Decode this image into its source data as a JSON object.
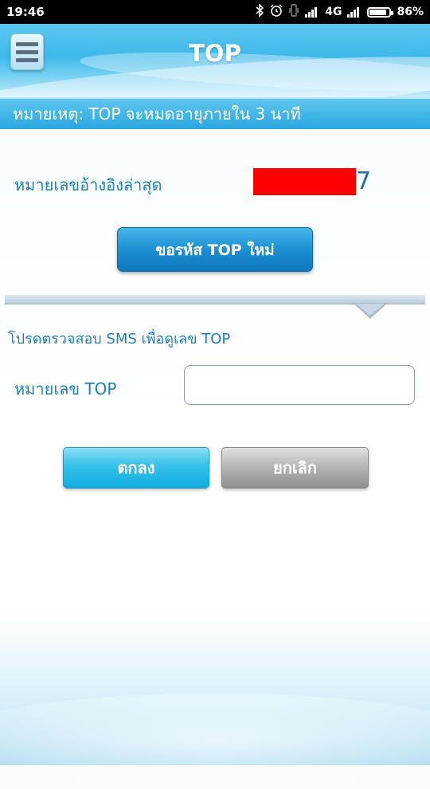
{
  "status_bar": {
    "time": "19:46",
    "network": "4G",
    "battery_percent": "86%",
    "battery_level": 0.86,
    "icons": [
      "bluetooth-icon",
      "alarm-icon",
      "vibrate-icon",
      "signal-icon",
      "signal-icon",
      "battery-icon"
    ]
  },
  "header": {
    "title": "TOP",
    "menu_icon": "hamburger-menu-icon"
  },
  "notice": {
    "text": "หมายเหตุ: TOP จะหมดอายุภายใน 3 นาที"
  },
  "reference": {
    "label": "หมายเลขอ้างอิงล่าสุด",
    "value_visible_suffix": "7",
    "redacted": true
  },
  "new_code_button": {
    "label": "ขอรหัส TOP ใหม่"
  },
  "verify": {
    "hint": "โปรดตรวจสอบ SMS เพื่อดูเลข TOP",
    "field_label": "หมายเลข TOP",
    "field_value": "",
    "field_placeholder": ""
  },
  "actions": {
    "ok_label": "ตกลง",
    "cancel_label": "ยกเลิก"
  },
  "colors": {
    "accent": "#2aa7e0",
    "text_blue": "#1f80b8",
    "redaction": "#ff0000"
  }
}
